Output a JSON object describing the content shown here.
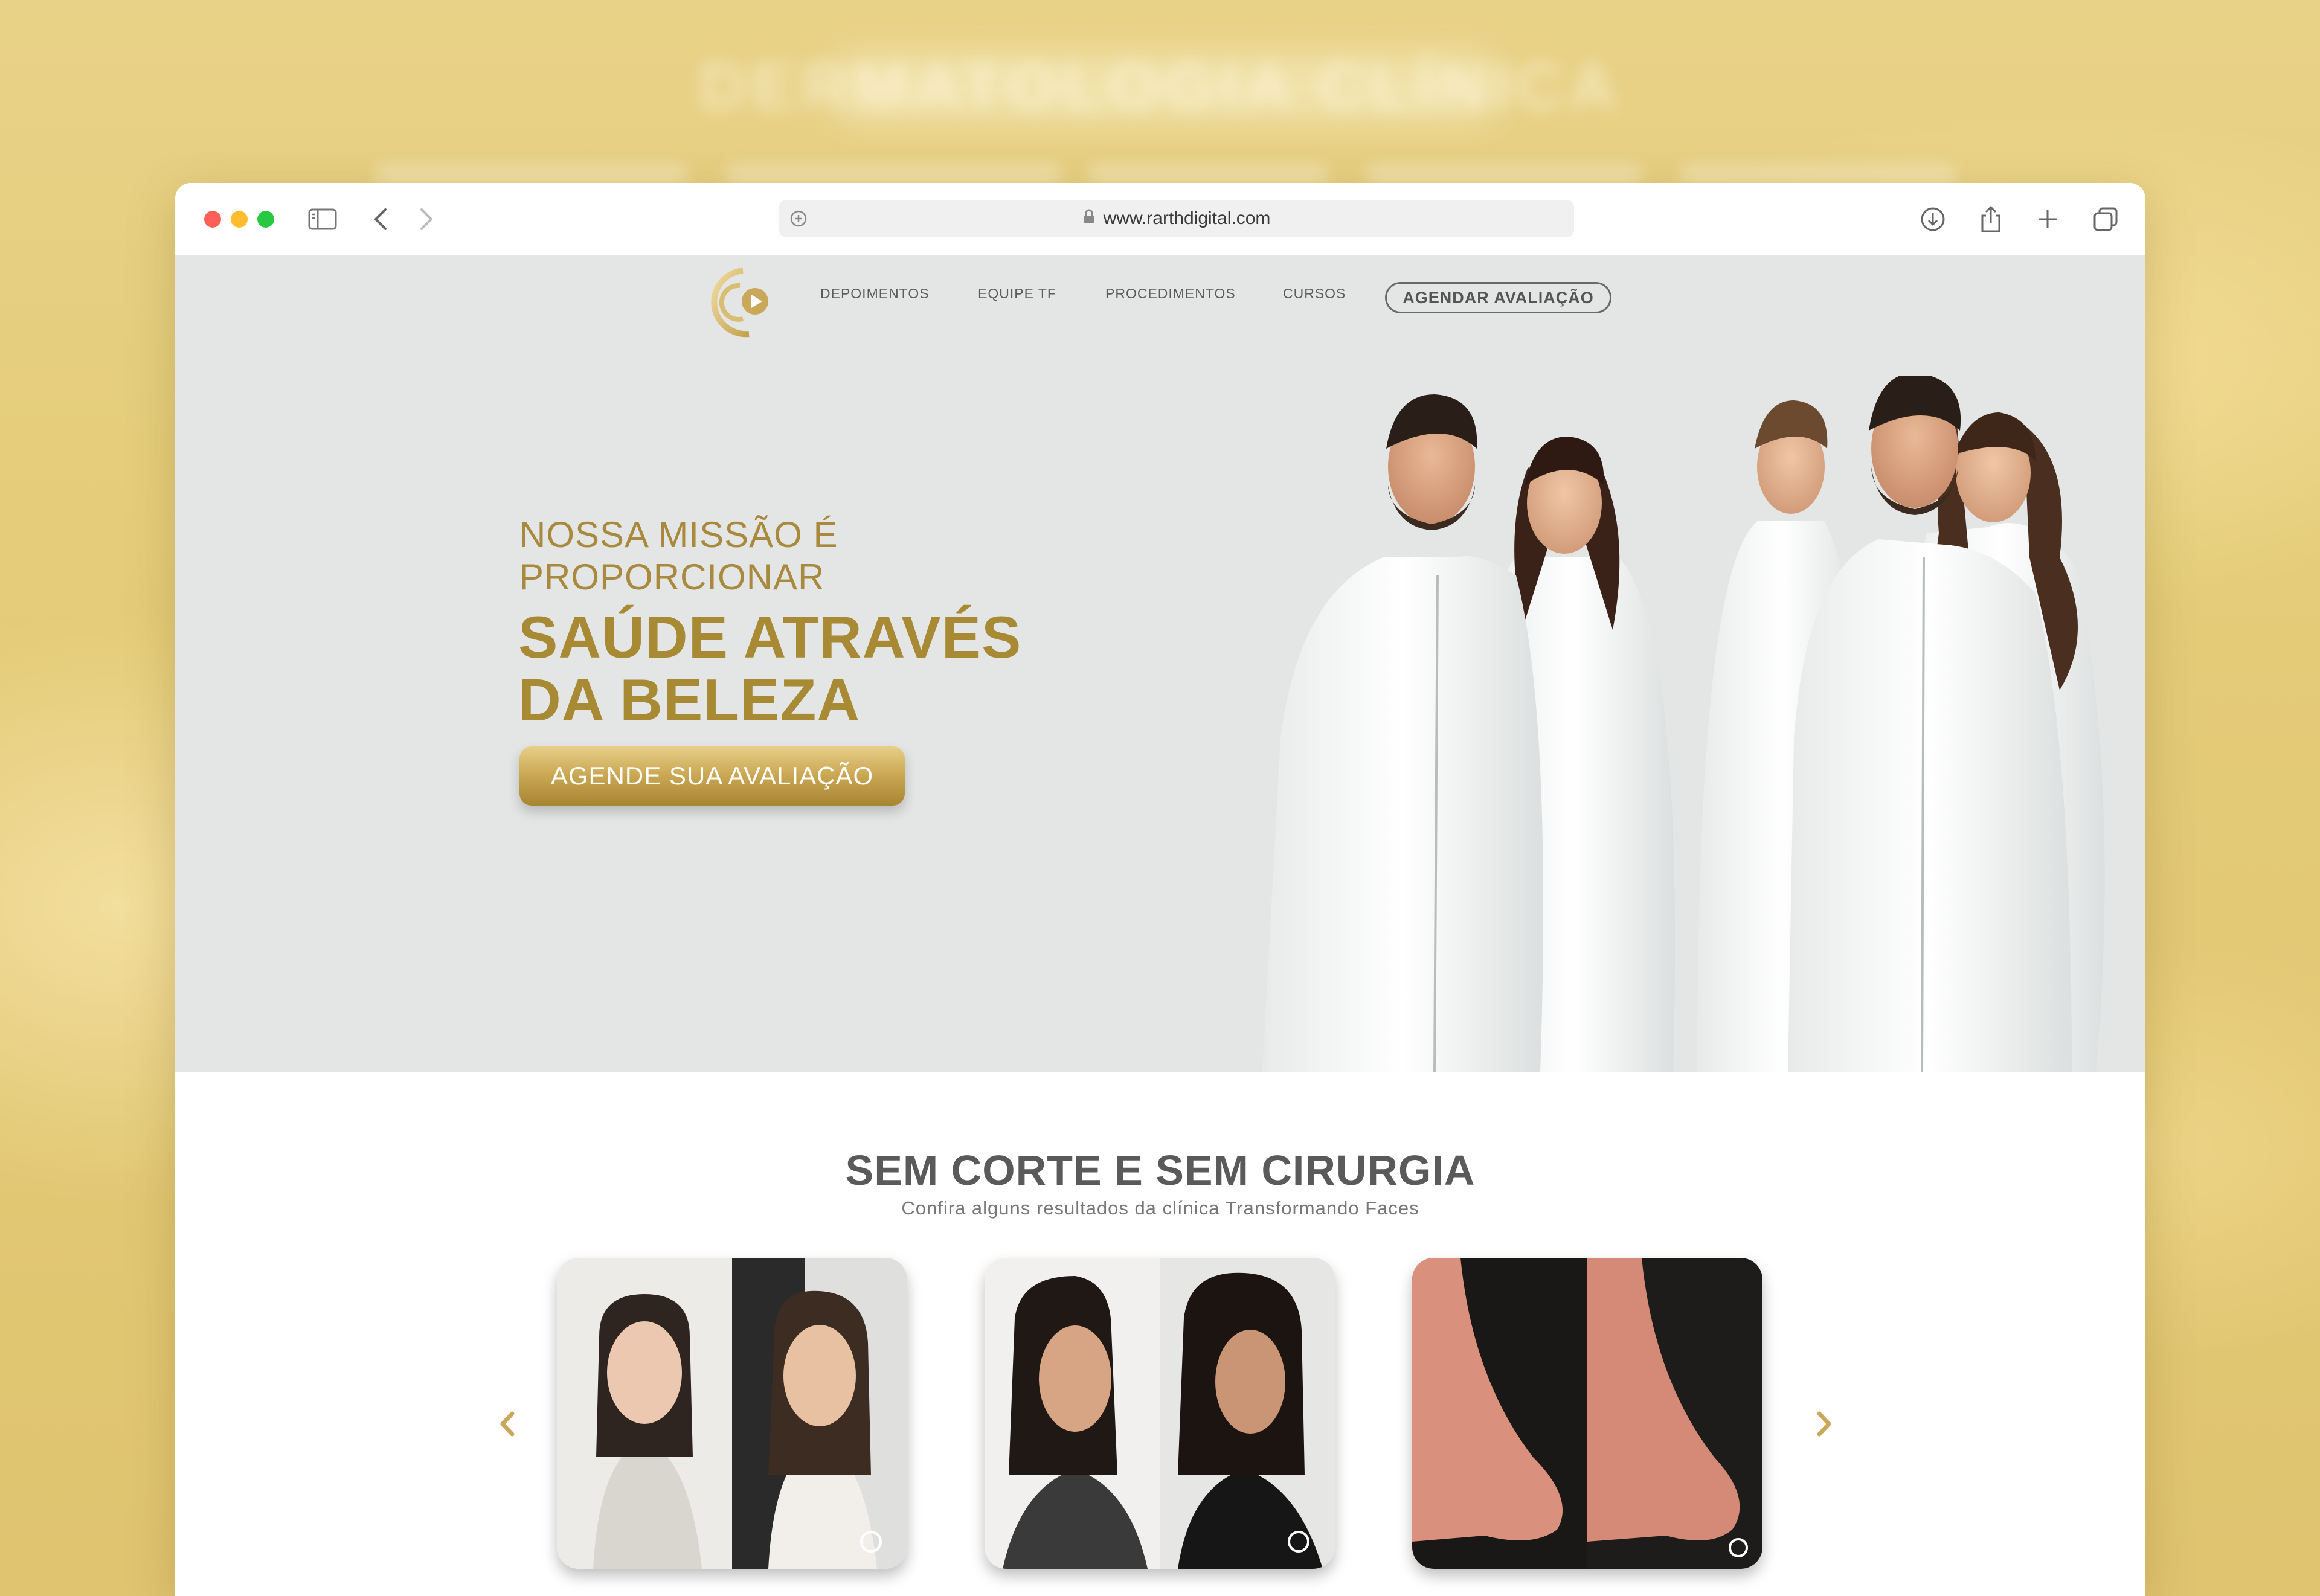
{
  "backdrop": {
    "title": "DERMATOLOGIA CLÍNICA"
  },
  "browser": {
    "url": "www.rarthdigital.com"
  },
  "nav": {
    "items": [
      "DEPOIMENTOS",
      "EQUIPE TF",
      "PROCEDIMENTOS",
      "CURSOS"
    ],
    "cta": "AGENDAR AVALIAÇÃO"
  },
  "hero": {
    "mission_line1": "NOSSA MISSÃO É",
    "mission_line2": "PROPORCIONAR",
    "headline_line1": "SAÚDE ATRAVÉS",
    "headline_line2": "DA BELEZA",
    "cta": "AGENDE SUA AVALIAÇÃO"
  },
  "results": {
    "title": "SEM CORTE E SEM CIRURGIA",
    "subtitle": "Confira alguns resultados da clínica Transformando Faces"
  },
  "colors": {
    "gold": "#a88a35",
    "hero_bg": "#e4e6e5",
    "backdrop": "#e2c97a"
  }
}
